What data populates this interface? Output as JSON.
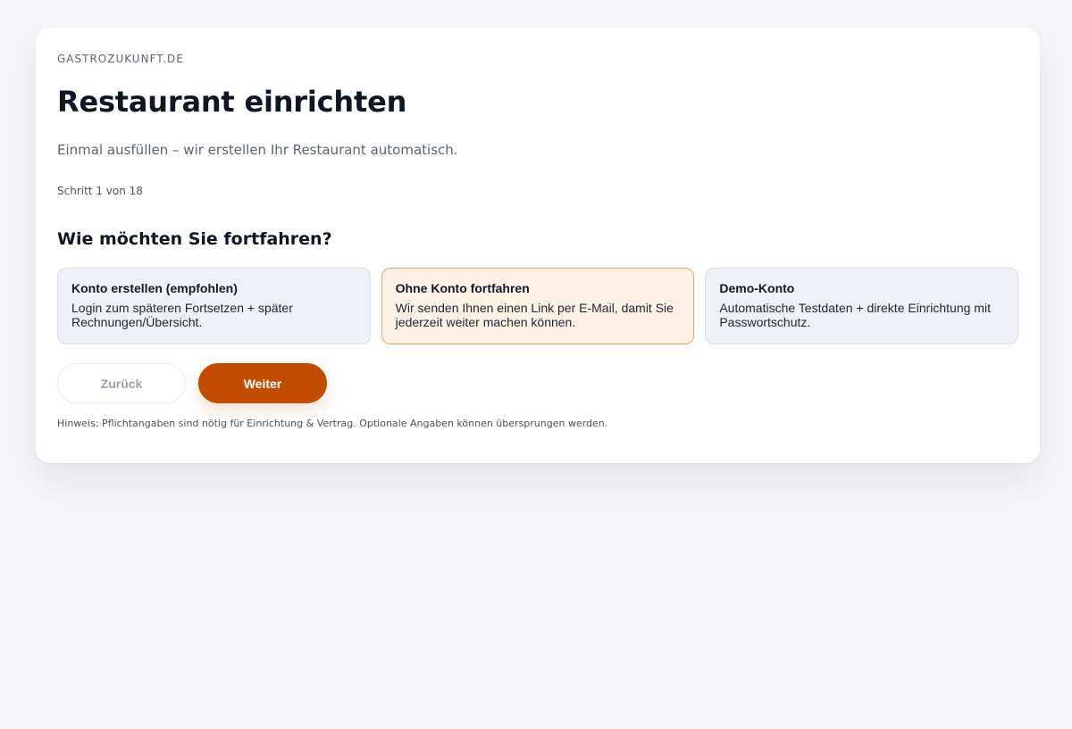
{
  "brand": "GASTROZUKUNFT.DE",
  "title": "Restaurant einrichten",
  "subtitle": "Einmal ausfüllen – wir erstellen Ihr Restaurant automatisch.",
  "step": "Schritt 1 von 18",
  "question": "Wie möchten Sie fortfahren?",
  "options": [
    {
      "title": "Konto erstellen (empfohlen)",
      "description": "Login zum späteren Fortsetzen + später Rechnungen/Übersicht.",
      "selected": false
    },
    {
      "title": "Ohne Konto fortfahren",
      "description": "Wir senden Ihnen einen Link per E-Mail, damit Sie jederzeit weiter machen können.",
      "selected": true
    },
    {
      "title": "Demo-Konto",
      "description": "Automatische Testdaten + direkte Einrichtung mit Passwortschutz.",
      "selected": false
    }
  ],
  "buttons": {
    "back_label": "Zurück",
    "next_label": "Weiter"
  },
  "hint": "Hinweis: Pflichtangaben sind nötig für Einrichtung & Vertrag. Optionale Angaben können übersprungen werden.",
  "colors": {
    "accent": "#c24d00",
    "selected_background": "#fff1e6",
    "selected_border": "#f0a25d",
    "option_background": "#eef1f7",
    "page_background": "#f5f6f9"
  }
}
